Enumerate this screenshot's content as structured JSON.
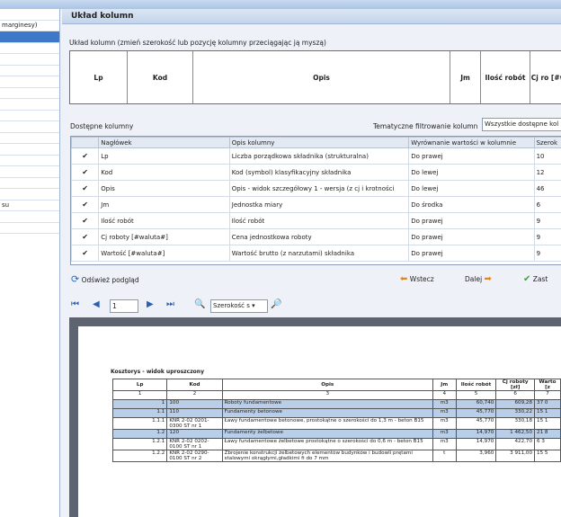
{
  "left_panel": {
    "items": [
      "",
      "marginesy)",
      "",
      "",
      "",
      "",
      "",
      "",
      "",
      "",
      "",
      "",
      "",
      "",
      "",
      "",
      "",
      "su",
      "",
      ""
    ]
  },
  "title": "Układ kolumn",
  "description": "Układ kolumn (zmień szerokość lub pozycję kolumny przeciągając ją myszą)",
  "layout_columns": [
    "Lp",
    "Kod",
    "Opis",
    "Jm",
    "Ilość robót",
    "Cj ro [#wal"
  ],
  "available_label": "Dostępne kolumny",
  "filter_label": "Tematyczne filtrowanie kolumn",
  "filter_value": "Wszystkie dostępne kol",
  "grid": {
    "headers": [
      "",
      "Nagłówek",
      "Opis kolumny",
      "Wyrównanie wartości w kolumnie",
      "Szerok"
    ],
    "rows": [
      {
        "check": "✔",
        "header": "Lp",
        "desc": "Liczba porządkowa składnika (strukturalna)",
        "align": "Do prawej",
        "width": "10"
      },
      {
        "check": "✔",
        "header": "Kod",
        "desc": "Kod (symbol) klasyfikacyjny składnika",
        "align": "Do lewej",
        "width": "12"
      },
      {
        "check": "✔",
        "header": "Opis",
        "desc": "Opis - widok szczegółowy 1 - wersja (z cj i krotności",
        "align": "Do lewej",
        "width": "46"
      },
      {
        "check": "✔",
        "header": "Jm",
        "desc": "Jednostka miary",
        "align": "Do środka",
        "width": "6"
      },
      {
        "check": "✔",
        "header": "Ilość robót",
        "desc": "Ilość robót",
        "align": "Do prawej",
        "width": "9"
      },
      {
        "check": "✔",
        "header": "Cj roboty [#waluta#]",
        "desc": "Cena jednostkowa roboty",
        "align": "Do prawej",
        "width": "9"
      },
      {
        "check": "✔",
        "header": "Wartość [#waluta#]",
        "desc": "Wartość brutto (z narzutami) składnika",
        "align": "Do prawej",
        "width": "9"
      }
    ]
  },
  "buttons": {
    "refresh": "Odśwież podgląd",
    "back": "Wstecz",
    "next": "Dalej",
    "save": "Zast"
  },
  "toolbar": {
    "page": "1",
    "zoom": "Szerokość s"
  },
  "doc": {
    "title": "Kosztorys - widok uproszczony",
    "headers": [
      "Lp",
      "Kod",
      "Opis",
      "Jm",
      "Ilość robót",
      "Cj roboty [zł]",
      "Warto [z"
    ],
    "numbers": [
      "1",
      "2",
      "3",
      "4",
      "5",
      "6",
      "7"
    ],
    "rows": [
      {
        "lp": "1",
        "kod": "100",
        "opis": "Roboty fundamentowe",
        "jm": "m3",
        "ilosc": "60,740",
        "cj": "609,28",
        "wart": "37 0",
        "hl": true
      },
      {
        "lp": "1.1",
        "kod": "110",
        "opis": "Fundamenty betonowe",
        "jm": "m3",
        "ilosc": "45,770",
        "cj": "330,22",
        "wart": "15 1",
        "hl": true
      },
      {
        "lp": "1.1.1",
        "kod": "KNR 2-02 0201-0300 ST nr 1",
        "opis": "Ławy fundamentowe betonowe, prostokątne o szerokości do 1,3 m - beton B15",
        "jm": "m3",
        "ilosc": "45,770",
        "cj": "330,18",
        "wart": "15 1",
        "hl": false
      },
      {
        "lp": "1.2",
        "kod": "120",
        "opis": "Fundamenty żelbetowe",
        "jm": "m3",
        "ilosc": "14,970",
        "cj": "1 462,50",
        "wart": "21 8",
        "hl": true
      },
      {
        "lp": "1.2.1",
        "kod": "KNR 2-02 0202-0100 ST nr 1",
        "opis": "Ławy fundamentowe żelbetowe prostokątne o szerokości do 0,6 m - beton B15",
        "jm": "m3",
        "ilosc": "14,970",
        "cj": "422,70",
        "wart": "6 3",
        "hl": false
      },
      {
        "lp": "1.2.2",
        "kod": "KNR 2-02 0290-0100 ST nr 2",
        "opis": "Zbrojenie konstrukcji żelbetowych elementów budynków i budowli prętami stalowymi okrągłymi,gładkimi fi do 7 mm",
        "jm": "t",
        "ilosc": "3,960",
        "cj": "3 911,00",
        "wart": "15 5",
        "hl": false
      }
    ]
  }
}
